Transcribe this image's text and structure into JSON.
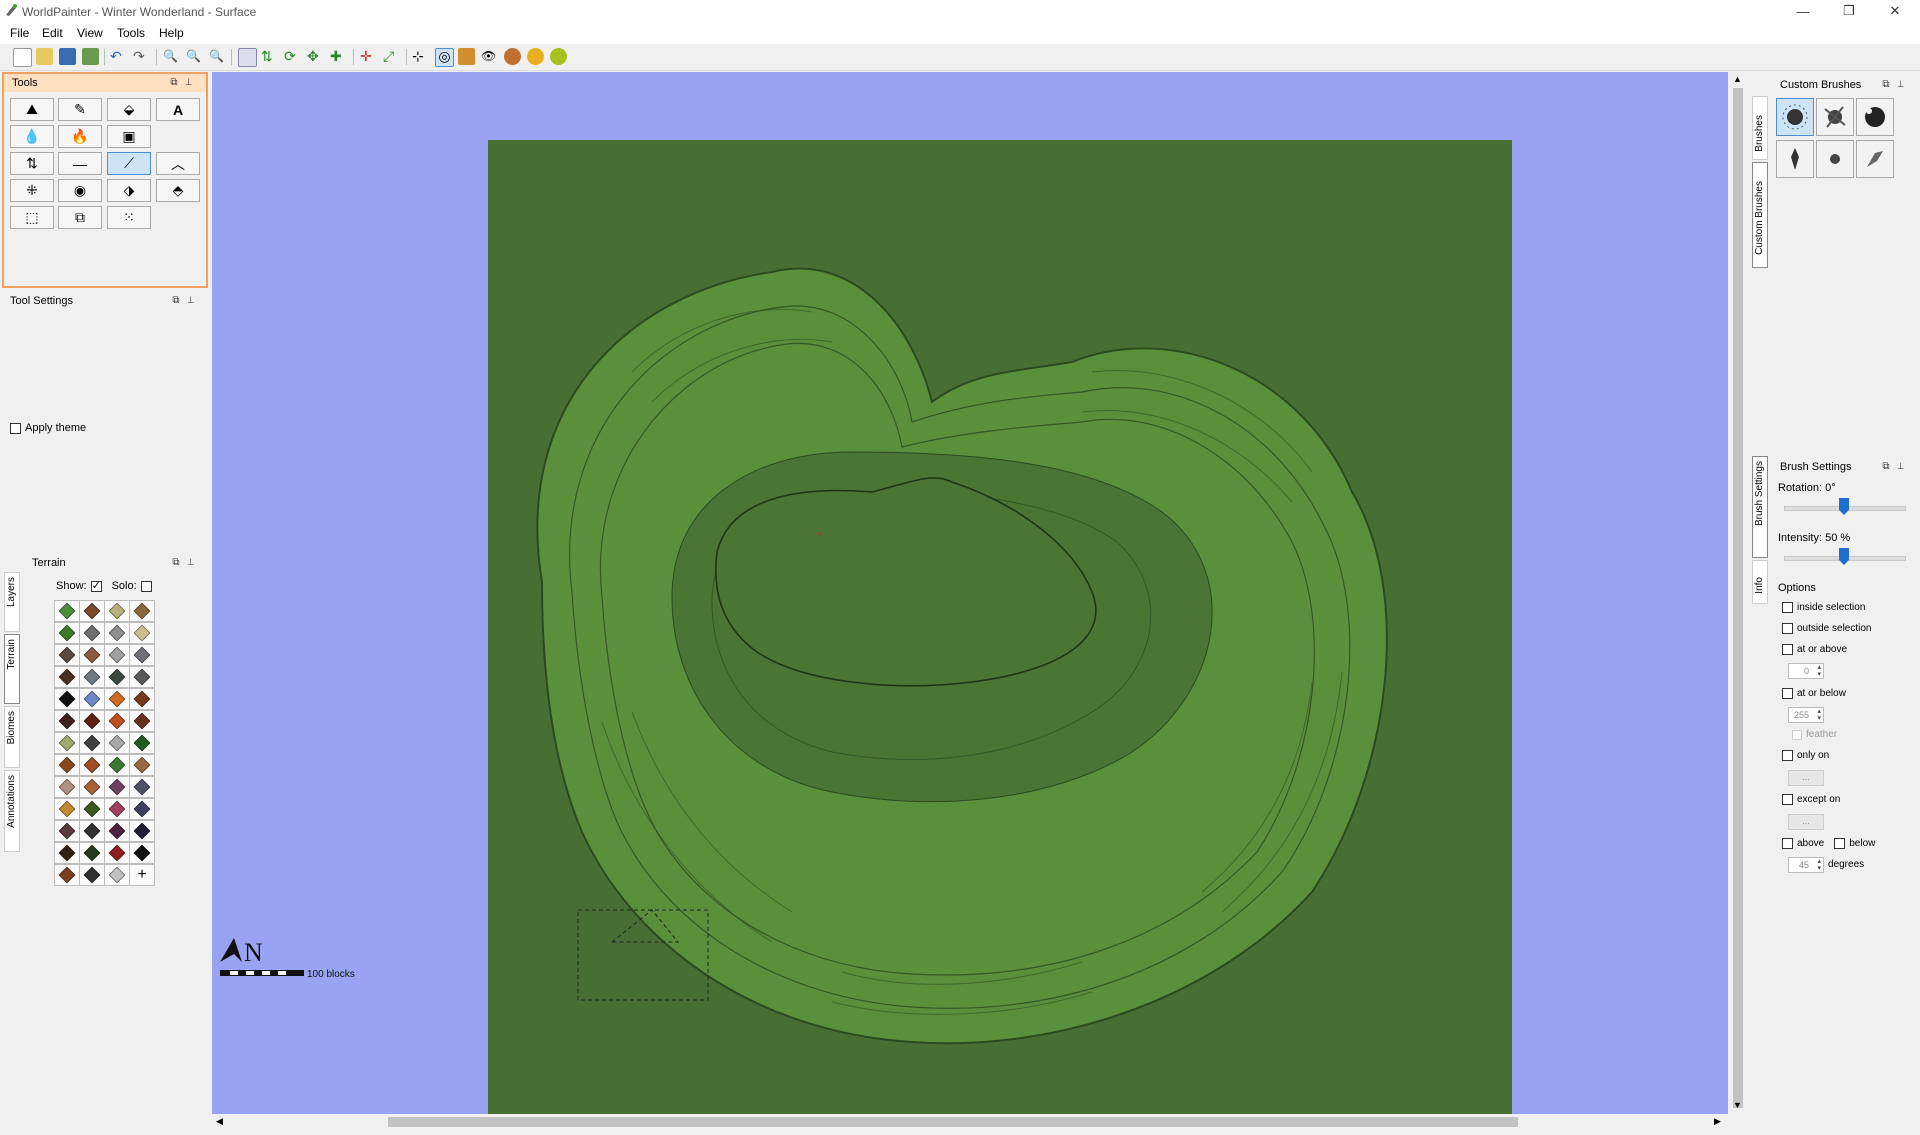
{
  "window": {
    "title": "WorldPainter - Winter Wonderland - Surface",
    "minimize": "—",
    "maximize": "❐",
    "close": "✕"
  },
  "menu": [
    "File",
    "Edit",
    "View",
    "Tools",
    "Help"
  ],
  "tools_panel": {
    "title": "Tools"
  },
  "tool_settings": {
    "title": "Tool Settings",
    "apply_theme": "Apply theme"
  },
  "terrain_panel": {
    "title": "Terrain",
    "show_label": "Show:",
    "solo_label": "Solo:",
    "show_checked": true,
    "solo_checked": false
  },
  "left_tabs": [
    "Layers",
    "Terrain",
    "Biomes",
    "Annotations"
  ],
  "right_tabs_top": [
    "Brushes",
    "Custom Brushes"
  ],
  "right_tabs_bottom": [
    "Brush Settings",
    "Info"
  ],
  "custom_brushes": {
    "title": "Custom Brushes"
  },
  "brush_settings": {
    "title": "Brush Settings",
    "rotation": "Rotation: 0°",
    "rotation_value": 0,
    "intensity": "Intensity: 50 %",
    "intensity_value": 50,
    "options_label": "Options",
    "inside_selection": "inside selection",
    "outside_selection": "outside selection",
    "at_or_above": "at or above",
    "at_or_above_value": "0",
    "at_or_below": "at or below",
    "at_or_below_value": "255",
    "feather": "feather",
    "only_on": "only on",
    "only_on_value": "...",
    "except_on": "except on",
    "except_on_value": "...",
    "above": "above",
    "below": "below",
    "degrees_value": "45",
    "degrees": "degrees"
  },
  "map": {
    "compass": "N",
    "scale_label": "100 blocks",
    "background": "#98a4f2",
    "ground": "#476f33"
  },
  "terrain_colors": [
    [
      "#4c8c3a",
      "#7a4a2a",
      "#b8b078",
      "#8a6a3a"
    ],
    [
      "#3e7a2a",
      "#6e6e6e",
      "#8e8e8e",
      "#c8c090"
    ],
    [
      "#5a4a40",
      "#8a5a40",
      "#a0a0a0",
      "#707078"
    ],
    [
      "#4a3020",
      "#707880",
      "#3a4a40",
      "#5a5a5a"
    ],
    [
      "#101010",
      "#7088c8",
      "#d06a20",
      "#7a3a20"
    ],
    [
      "#402020",
      "#602010",
      "#c05020",
      "#6a3020"
    ],
    [
      "#a0a870",
      "#404040",
      "#a8a8a8",
      "#205a20"
    ],
    [
      "#8a4a20",
      "#a05020",
      "#3a7a30",
      "#9a6a40"
    ],
    [
      "#b09080",
      "#a86038",
      "#704060",
      "#50506a"
    ],
    [
      "#c08a30",
      "#3a5a20",
      "#a04060",
      "#404060"
    ],
    [
      "#5a3a40",
      "#303030",
      "#502040",
      "#202030"
    ],
    [
      "#302010",
      "#2a3a20",
      "#902020",
      "#101010"
    ],
    [
      "#7a4020",
      "#303030",
      "#c0c0c0",
      "plus"
    ]
  ]
}
